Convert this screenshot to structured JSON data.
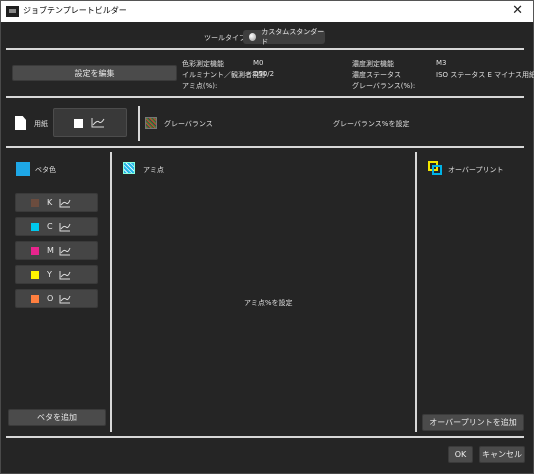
{
  "window": {
    "title": "ジョブテンプレートビルダー",
    "close_glyph": "✕"
  },
  "tool_type": {
    "label": "ツールタイプ",
    "value": "カスタムスタンダード"
  },
  "edit_settings_button": "設定を編集",
  "settings": {
    "color_device_label": "色彩測定機能",
    "color_device_value": "M0",
    "illuminant_label": "イルミナント／観測者視野",
    "illuminant_value": "D50/2",
    "ami_label": "アミ点(%):",
    "density_device_label": "濃度測定機能",
    "density_device_value": "M3",
    "density_status_label": "濃度ステータス",
    "density_status_value": "ISO ステータス E マイナス用紙",
    "gray_balance_label": "グレーバランス(%):"
  },
  "paper": {
    "label": "用紙"
  },
  "gray_balance": {
    "label": "グレーバランス",
    "not_set": "グレーバランス%を設定"
  },
  "solid": {
    "label": "ベタ色",
    "inks": [
      {
        "letter": "K",
        "color": "#6b4c3e"
      },
      {
        "letter": "C",
        "color": "#00c8ee"
      },
      {
        "letter": "M",
        "color": "#e8258d"
      },
      {
        "letter": "Y",
        "color": "#fff200"
      },
      {
        "letter": "O",
        "color": "#ff7f3f"
      }
    ],
    "add_button": "ベタを追加"
  },
  "ami": {
    "label": "アミ点",
    "not_set": "アミ点%を設定"
  },
  "overprint": {
    "label": "オーバープリント",
    "add_button": "オーバープリントを追加"
  },
  "footer": {
    "ok": "OK",
    "cancel": "キャンセル"
  },
  "colors": {
    "background": "#252525",
    "button": "#4b4b4b",
    "divider": "#d8d8d8",
    "solid_icon": "#1ea7e6"
  }
}
